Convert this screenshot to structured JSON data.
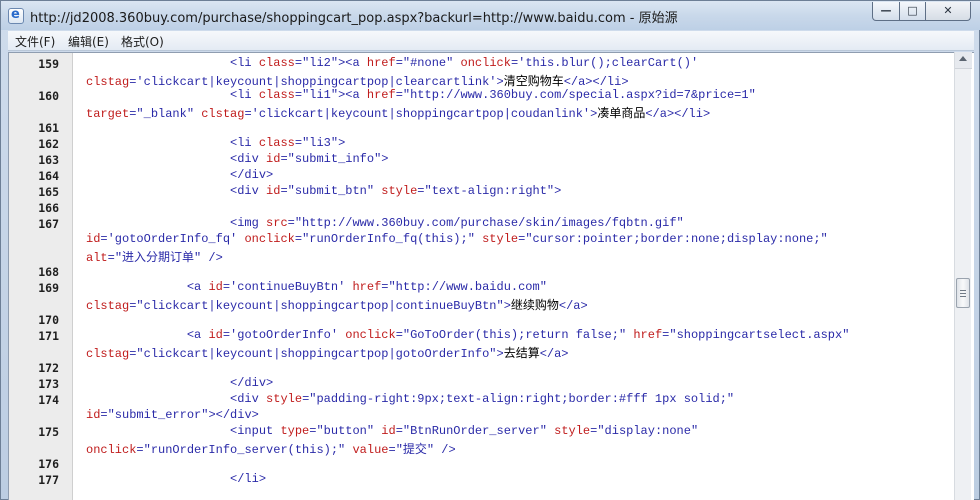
{
  "window": {
    "title": "http://jd2008.360buy.com/purchase/shoppingcart_pop.aspx?backurl=http://www.baidu.com - 原始源",
    "controls": {
      "minimize": "—",
      "maximize": "□",
      "close": "✕"
    }
  },
  "menu": {
    "items": [
      {
        "label": "文件(F)"
      },
      {
        "label": "编辑(E)"
      },
      {
        "label": "格式(O)"
      }
    ]
  },
  "editor": {
    "gutter_numbers": [
      "159",
      "",
      "160",
      "",
      "161",
      "162",
      "163",
      "164",
      "165",
      "166",
      "167",
      "",
      "",
      "168",
      "169",
      "",
      "170",
      "171",
      "",
      "172",
      "173",
      "174",
      "",
      "175",
      "",
      "176",
      "177"
    ],
    "lines": [
      [
        [
          "",
          "                    "
        ],
        [
          "t",
          "<li "
        ],
        [
          "a",
          "class"
        ],
        [
          "t",
          "="
        ],
        [
          "v",
          "\"li2\""
        ],
        [
          "t",
          "><a "
        ],
        [
          "a",
          "href"
        ],
        [
          "t",
          "="
        ],
        [
          "v",
          "\"#none\""
        ],
        [
          "t",
          " "
        ],
        [
          "a",
          "onclick"
        ],
        [
          "t",
          "="
        ],
        [
          "v",
          "'this.blur();clearCart()'"
        ]
      ],
      [
        [
          "a",
          "clstag"
        ],
        [
          "t",
          "="
        ],
        [
          "v",
          "'clickcart|keycount|shoppingcartpop|clearcartlink'"
        ],
        [
          "t",
          ">"
        ],
        [
          "x",
          "清空购物车"
        ],
        [
          "t",
          "</a></li>"
        ]
      ],
      [
        [
          "",
          "                    "
        ],
        [
          "t",
          "<li "
        ],
        [
          "a",
          "class"
        ],
        [
          "t",
          "="
        ],
        [
          "v",
          "\"li1\""
        ],
        [
          "t",
          "><a "
        ],
        [
          "a",
          "href"
        ],
        [
          "t",
          "="
        ],
        [
          "v",
          "\"http://www.360buy.com/special.aspx?id=7&price=1\""
        ]
      ],
      [
        [
          "a",
          "target"
        ],
        [
          "t",
          "="
        ],
        [
          "v",
          "\"_blank\""
        ],
        [
          "t",
          " "
        ],
        [
          "a",
          "clstag"
        ],
        [
          "t",
          "="
        ],
        [
          "v",
          "'clickcart|keycount|shoppingcartpop|coudanlink'"
        ],
        [
          "t",
          ">"
        ],
        [
          "x",
          "凑单商品"
        ],
        [
          "t",
          "</a></li>"
        ]
      ],
      [],
      [
        [
          "",
          "                    "
        ],
        [
          "t",
          "<li "
        ],
        [
          "a",
          "class"
        ],
        [
          "t",
          "="
        ],
        [
          "v",
          "\"li3\""
        ],
        [
          "t",
          ">"
        ]
      ],
      [
        [
          "",
          "                    "
        ],
        [
          "t",
          "<div "
        ],
        [
          "a",
          "id"
        ],
        [
          "t",
          "="
        ],
        [
          "v",
          "\"submit_info\""
        ],
        [
          "t",
          ">"
        ]
      ],
      [
        [
          "",
          "                    "
        ],
        [
          "t",
          "</div>"
        ]
      ],
      [
        [
          "",
          "                    "
        ],
        [
          "t",
          "<div "
        ],
        [
          "a",
          "id"
        ],
        [
          "t",
          "="
        ],
        [
          "v",
          "\"submit_btn\""
        ],
        [
          "t",
          " "
        ],
        [
          "a",
          "style"
        ],
        [
          "t",
          "="
        ],
        [
          "v",
          "\"text-align:right\""
        ],
        [
          "t",
          ">"
        ]
      ],
      [],
      [
        [
          "",
          "                    "
        ],
        [
          "t",
          "<img "
        ],
        [
          "a",
          "src"
        ],
        [
          "t",
          "="
        ],
        [
          "v",
          "\"http://www.360buy.com/purchase/skin/images/fqbtn.gif\""
        ]
      ],
      [
        [
          "a",
          "id"
        ],
        [
          "t",
          "="
        ],
        [
          "v",
          "'gotoOrderInfo_fq'"
        ],
        [
          "t",
          " "
        ],
        [
          "a",
          "onclick"
        ],
        [
          "t",
          "="
        ],
        [
          "v",
          "\"runOrderInfo_fq(this);\""
        ],
        [
          "t",
          " "
        ],
        [
          "a",
          "style"
        ],
        [
          "t",
          "="
        ],
        [
          "v",
          "\"cursor:pointer;border:none;display:none;\""
        ]
      ],
      [
        [
          "a",
          "alt"
        ],
        [
          "t",
          "="
        ],
        [
          "v",
          "\"进入分期订单\""
        ],
        [
          "t",
          " />"
        ]
      ],
      [],
      [
        [
          "",
          "              "
        ],
        [
          "t",
          "<a "
        ],
        [
          "a",
          "id"
        ],
        [
          "t",
          "="
        ],
        [
          "v",
          "'continueBuyBtn'"
        ],
        [
          "t",
          " "
        ],
        [
          "a",
          "href"
        ],
        [
          "t",
          "="
        ],
        [
          "v",
          "\"http://www.baidu.com\""
        ]
      ],
      [
        [
          "a",
          "clstag"
        ],
        [
          "t",
          "="
        ],
        [
          "v",
          "\"clickcart|keycount|shoppingcartpop|continueBuyBtn\""
        ],
        [
          "t",
          ">"
        ],
        [
          "x",
          "继续购物"
        ],
        [
          "t",
          "</a>"
        ]
      ],
      [],
      [
        [
          "",
          "              "
        ],
        [
          "t",
          "<a "
        ],
        [
          "a",
          "id"
        ],
        [
          "t",
          "="
        ],
        [
          "v",
          "'gotoOrderInfo'"
        ],
        [
          "t",
          " "
        ],
        [
          "a",
          "onclick"
        ],
        [
          "t",
          "="
        ],
        [
          "v",
          "\"GoToOrder(this);return false;\""
        ],
        [
          "t",
          " "
        ],
        [
          "a",
          "href"
        ],
        [
          "t",
          "="
        ],
        [
          "v",
          "\"shoppingcartselect.aspx\""
        ]
      ],
      [
        [
          "a",
          "clstag"
        ],
        [
          "t",
          "="
        ],
        [
          "v",
          "\"clickcart|keycount|shoppingcartpop|gotoOrderInfo\""
        ],
        [
          "t",
          ">"
        ],
        [
          "x",
          "去结算"
        ],
        [
          "t",
          "</a>"
        ]
      ],
      [],
      [
        [
          "",
          "                    "
        ],
        [
          "t",
          "</div>"
        ]
      ],
      [
        [
          "",
          "                    "
        ],
        [
          "t",
          "<div "
        ],
        [
          "a",
          "style"
        ],
        [
          "t",
          "="
        ],
        [
          "v",
          "\"padding-right:9px;text-align:right;border:#fff 1px solid;\""
        ]
      ],
      [
        [
          "a",
          "id"
        ],
        [
          "t",
          "="
        ],
        [
          "v",
          "\"submit_error\""
        ],
        [
          "t",
          "></div>"
        ]
      ],
      [
        [
          "",
          "                    "
        ],
        [
          "t",
          "<input "
        ],
        [
          "a",
          "type"
        ],
        [
          "t",
          "="
        ],
        [
          "v",
          "\"button\""
        ],
        [
          "t",
          " "
        ],
        [
          "a",
          "id"
        ],
        [
          "t",
          "="
        ],
        [
          "v",
          "\"BtnRunOrder_server\""
        ],
        [
          "t",
          " "
        ],
        [
          "a",
          "style"
        ],
        [
          "t",
          "="
        ],
        [
          "v",
          "\"display:none\""
        ]
      ],
      [
        [
          "a",
          "onclick"
        ],
        [
          "t",
          "="
        ],
        [
          "v",
          "\"runOrderInfo_server(this);\""
        ],
        [
          "t",
          " "
        ],
        [
          "a",
          "value"
        ],
        [
          "t",
          "="
        ],
        [
          "v",
          "\"提交\""
        ],
        [
          "t",
          " />"
        ]
      ],
      [],
      [
        [
          "",
          "                    "
        ],
        [
          "t",
          "</li>"
        ]
      ]
    ]
  },
  "syntax_colors": {
    "tag": "#2a2aa8",
    "attribute": "#c01c1c",
    "value": "#2a2aa8",
    "text": "#000000"
  },
  "icons": {
    "app": "ie-icon",
    "scroll_up": "scroll-up-arrow-icon"
  }
}
